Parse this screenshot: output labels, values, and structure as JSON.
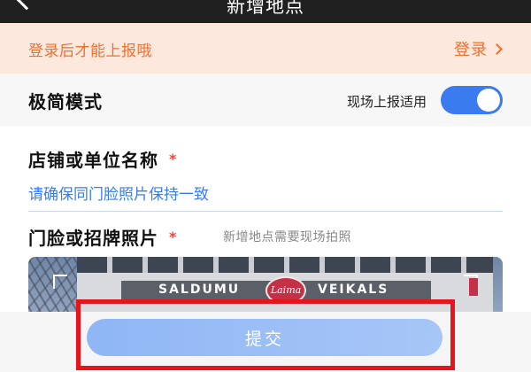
{
  "header": {
    "title": "新增地点",
    "back_icon": "chevron-left-icon"
  },
  "login_banner": {
    "message": "登录后才能上报哦",
    "link_label": "登录",
    "link_icon": "chevron-right-icon"
  },
  "simple_mode": {
    "label": "极简模式",
    "hint": "现场上报适用",
    "enabled": true
  },
  "form": {
    "shop_name": {
      "label": "店铺或单位名称",
      "required_mark": "*",
      "placeholder": "请确保同门脸照片保持一致",
      "value": ""
    },
    "storefront_photo": {
      "label": "门脸或招牌照片",
      "required_mark": "*",
      "note": "新增地点需要现场拍照",
      "sign_text_left": "SALDUMU",
      "sign_text_right": "VEIKALS",
      "logo_text": "Laima"
    }
  },
  "actions": {
    "submit_label": "提交"
  },
  "colors": {
    "accent_orange": "#f0702f",
    "toggle_blue": "#3a7cf0",
    "highlight_red": "#e8141b",
    "required_red": "#f0443a"
  }
}
